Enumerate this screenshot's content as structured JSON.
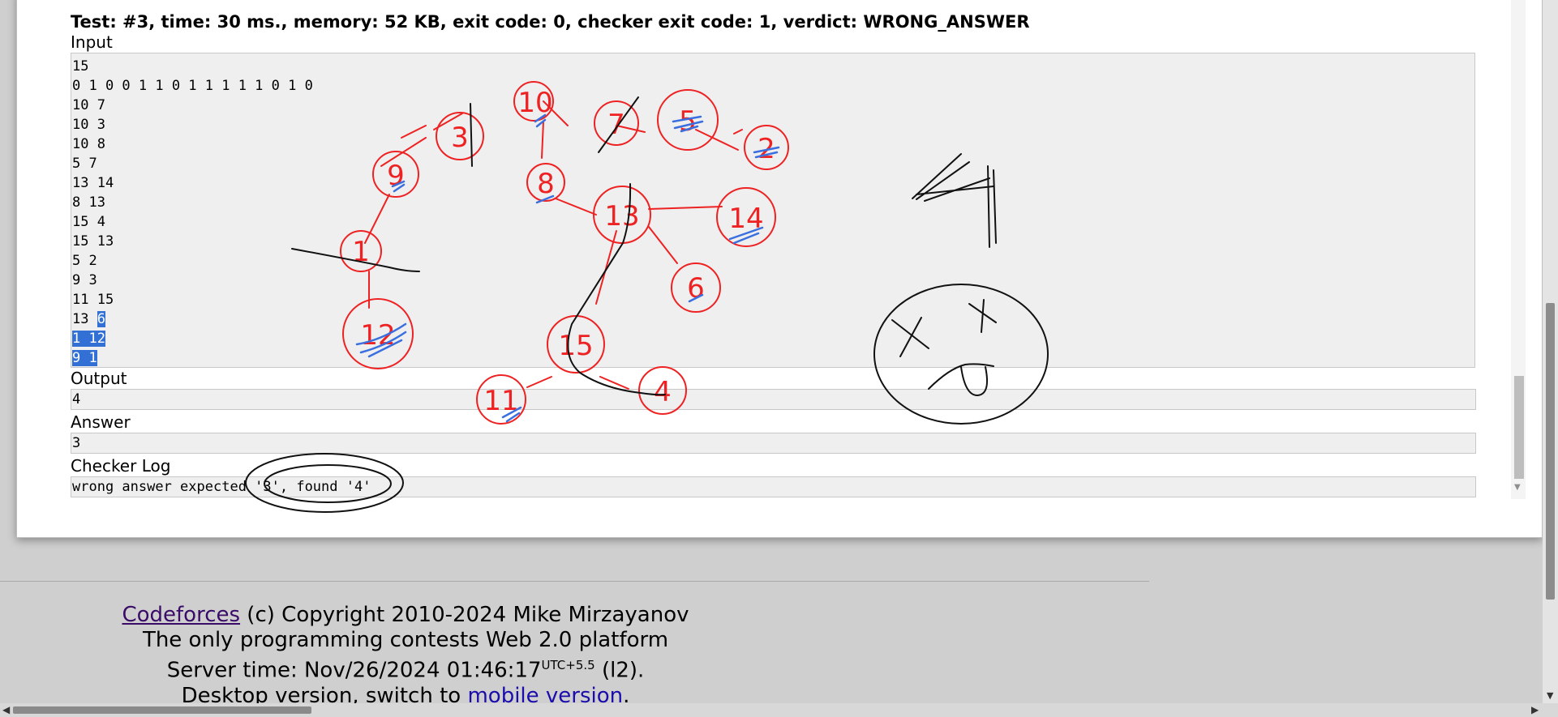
{
  "verdict": "Test: #3, time: 30 ms., memory: 52 KB, exit code: 0, checker exit code: 1, verdict: WRONG_ANSWER",
  "input": {
    "label": "Input",
    "lines": [
      "15",
      "0 1 0 0 1 1 0 1 1 1 1 1 0 1 0",
      "10 7",
      "10 3",
      "10 8",
      "5 7",
      "13 14",
      "8 13",
      "15 4",
      "15 13",
      "5 2",
      "9 3",
      "11 15"
    ],
    "partial_line": {
      "before": "13 ",
      "selected": "6"
    },
    "selected_lines": [
      "1 12",
      "9 1"
    ]
  },
  "output": {
    "label": "Output",
    "value": "4"
  },
  "answer": {
    "label": "Answer",
    "value": "3"
  },
  "checker": {
    "label": "Checker Log",
    "value": "wrong answer expected '3', found '4'"
  },
  "drawing": {
    "node_labels": [
      "10",
      "3",
      "9",
      "1",
      "12",
      "7",
      "5",
      "2",
      "8",
      "13",
      "14",
      "6",
      "15",
      "11",
      "4"
    ],
    "big_number": "4"
  },
  "footer": {
    "link_codeforces": "Codeforces",
    "copyright": " (c) Copyright 2010-2024 Mike Mirzayanov",
    "tagline": "The only programming contests Web 2.0 platform",
    "server_time_prefix": "Server time: Nov/26/2024 01:46:17",
    "server_time_tz": "UTC+5.5",
    "server_time_suffix": " (l2).",
    "desktop_prefix": "Desktop version, switch to ",
    "mobile_link": "mobile version",
    "desktop_suffix": "."
  },
  "colors": {
    "selection": "#3370d6",
    "drawing_red": "#ee2222",
    "drawing_blue": "#3a6fe0",
    "drawing_black": "#111111"
  }
}
